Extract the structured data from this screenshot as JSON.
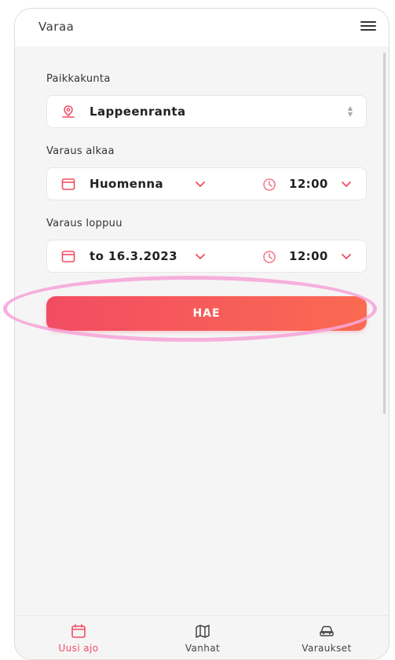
{
  "header": {
    "title": "Varaa",
    "menu_icon": "menu-icon"
  },
  "form": {
    "location": {
      "label": "Paikkakunta",
      "value": "Lappeenranta",
      "icon": "map-pin-icon"
    },
    "start": {
      "label": "Varaus alkaa",
      "date_value": "Huomenna",
      "time_value": "12:00"
    },
    "end": {
      "label": "Varaus loppuu",
      "date_value": "to 16.3.2023",
      "time_value": "12:00"
    },
    "search_button_label": "HAE"
  },
  "bottom_nav": {
    "items": [
      {
        "label": "Uusi ajo",
        "icon": "calendar-icon",
        "active": true
      },
      {
        "label": "Vanhat",
        "icon": "map-icon",
        "active": false
      },
      {
        "label": "Varaukset",
        "icon": "car-icon",
        "active": false
      }
    ]
  },
  "colors": {
    "accent": "#f24c62",
    "accent_end": "#fb6a52",
    "highlight": "#f6a7d9",
    "background": "#f5f5f5"
  }
}
